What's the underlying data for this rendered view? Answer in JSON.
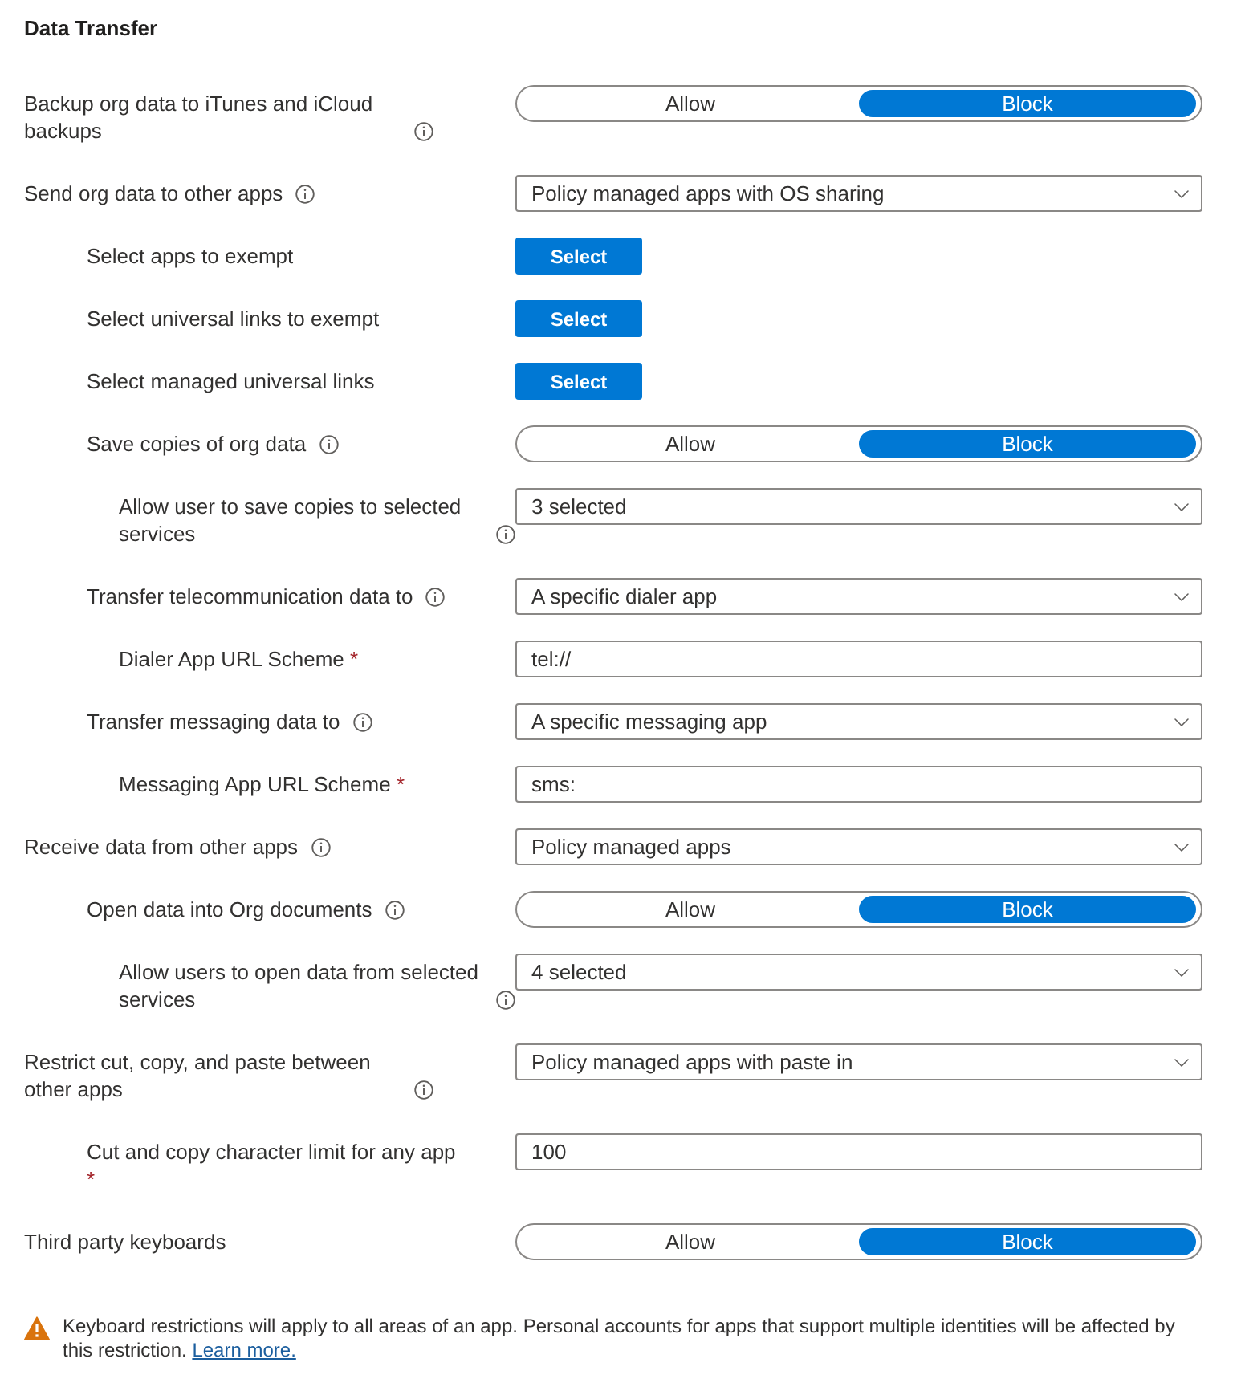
{
  "section": {
    "title": "Data Transfer"
  },
  "settings": [
    {
      "kind": "toggle",
      "label": "Backup org data to iTunes and iCloud backups",
      "info": true,
      "options": [
        {
          "label": "Allow",
          "selected": false
        },
        {
          "label": "Block",
          "selected": true
        }
      ]
    },
    {
      "kind": "dropdown",
      "label": "Send org data to other apps",
      "info": true,
      "value": "Policy managed apps with OS sharing",
      "children": [
        {
          "kind": "button",
          "label": "Select apps to exempt",
          "info": false,
          "button_label": "Select"
        },
        {
          "kind": "button",
          "label": "Select universal links to exempt",
          "info": false,
          "button_label": "Select"
        },
        {
          "kind": "button",
          "label": "Select managed universal links",
          "info": false,
          "button_label": "Select"
        },
        {
          "kind": "toggle",
          "label": "Save copies of org data",
          "info": true,
          "options": [
            {
              "label": "Allow",
              "selected": false
            },
            {
              "label": "Block",
              "selected": true
            }
          ],
          "children": [
            {
              "kind": "dropdown",
              "label": "Allow user to save copies to selected services",
              "info": true,
              "value": "3 selected"
            }
          ]
        },
        {
          "kind": "dropdown",
          "label": "Transfer telecommunication data to",
          "info": true,
          "value": "A specific dialer app",
          "children": [
            {
              "kind": "input",
              "label": "Dialer App URL Scheme",
              "info": false,
              "required_mark": "*",
              "value": "tel://"
            }
          ]
        },
        {
          "kind": "dropdown",
          "label": "Transfer messaging data to",
          "info": true,
          "value": "A specific messaging app",
          "children": [
            {
              "kind": "input",
              "label": "Messaging App URL Scheme",
              "info": false,
              "required_mark": "*",
              "value": "sms:"
            }
          ]
        }
      ]
    },
    {
      "kind": "dropdown",
      "label": "Receive data from other apps",
      "info": true,
      "value": "Policy managed apps",
      "children": [
        {
          "kind": "toggle",
          "label": "Open data into Org documents",
          "info": true,
          "options": [
            {
              "label": "Allow",
              "selected": false
            },
            {
              "label": "Block",
              "selected": true
            }
          ],
          "children": [
            {
              "kind": "dropdown",
              "label": "Allow users to open data from selected services",
              "info": true,
              "value": "4 selected"
            }
          ]
        }
      ]
    },
    {
      "kind": "dropdown",
      "label": "Restrict cut, copy, and paste between other apps",
      "info": true,
      "value": "Policy managed apps with paste in",
      "children": [
        {
          "kind": "input",
          "label": "Cut and copy character limit for any app",
          "info": false,
          "required_mark": "*",
          "value": "100"
        }
      ]
    },
    {
      "kind": "toggle",
      "label": "Third party keyboards",
      "info": false,
      "options": [
        {
          "label": "Allow",
          "selected": false
        },
        {
          "label": "Block",
          "selected": true
        }
      ]
    }
  ],
  "notice": {
    "kind": "warning",
    "text": "Keyboard restrictions will apply to all areas of an app. Personal accounts for apps that support multiple identities will be affected by this restriction.",
    "link": "Learn more."
  }
}
